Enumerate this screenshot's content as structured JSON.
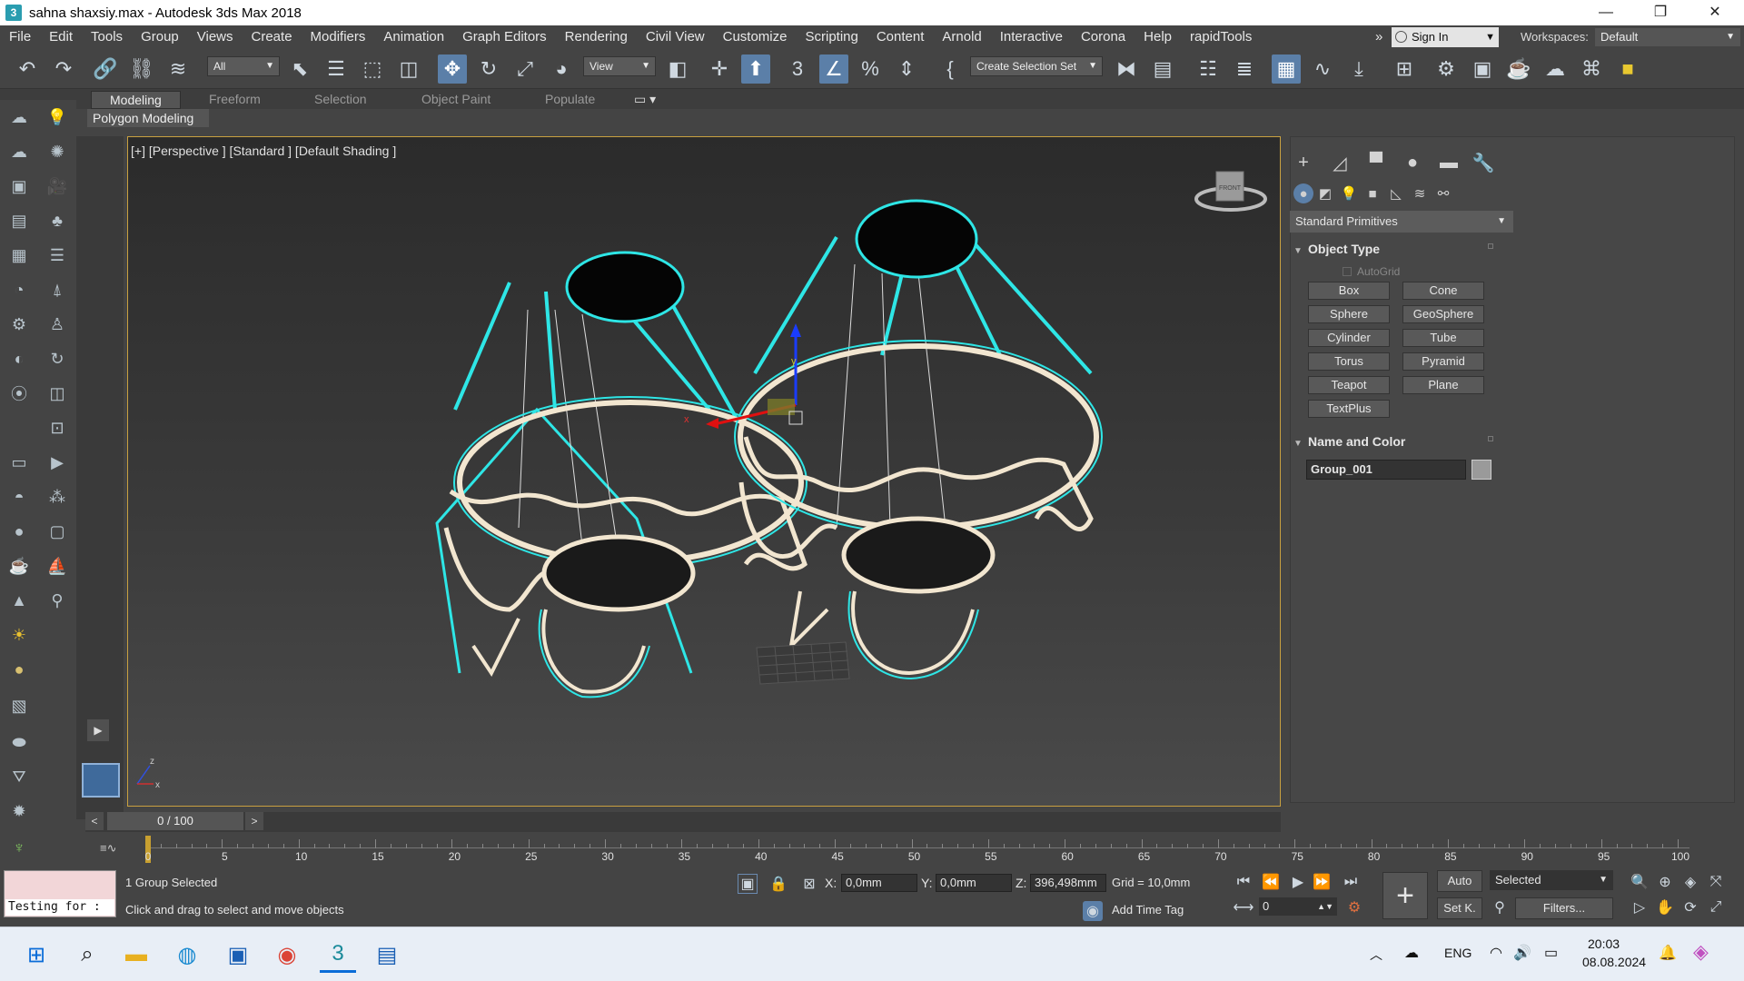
{
  "window": {
    "title": "sahna shaxsiy.max - Autodesk 3ds Max 2018",
    "app_icon": "3",
    "minimize": "—",
    "restore": "❐",
    "close": "✕"
  },
  "menu": [
    "File",
    "Edit",
    "Tools",
    "Group",
    "Views",
    "Create",
    "Modifiers",
    "Animation",
    "Graph Editors",
    "Rendering",
    "Civil View",
    "Customize",
    "Scripting",
    "Content",
    "Arnold",
    "Interactive",
    "Corona",
    "Help",
    "rapidTools"
  ],
  "menu_more": "»",
  "signin": {
    "label": "Sign In"
  },
  "workspace": {
    "label": "Workspaces:",
    "value": "Default"
  },
  "toolbar": {
    "filter_value": "All",
    "refcoord_value": "View",
    "selection_set": "Create Selection Set"
  },
  "ribbon": {
    "tabs": [
      "Modeling",
      "Freeform",
      "Selection",
      "Object Paint",
      "Populate"
    ],
    "active": "Modeling",
    "panel": "Polygon Modeling"
  },
  "viewport": {
    "label": "[+] [Perspective ] [Standard ] [Default Shading ]",
    "gizmo_x": "x",
    "gizmo_y": "y",
    "axis_x": "x",
    "axis_z": "z",
    "cube_label": "FRONT"
  },
  "command_panel": {
    "dropdown": "Standard Primitives",
    "object_type": {
      "title": "Object Type",
      "autogrid": "AutoGrid",
      "buttons": [
        "Box",
        "Cone",
        "Sphere",
        "GeoSphere",
        "Cylinder",
        "Tube",
        "Torus",
        "Pyramid",
        "Teapot",
        "Plane",
        "TextPlus"
      ]
    },
    "name_color": {
      "title": "Name and Color",
      "name": "Group_001",
      "swatch_color": "#9a9a9a"
    }
  },
  "timeline": {
    "position": "0 / 100",
    "ticks": [
      "0",
      "5",
      "10",
      "15",
      "20",
      "25",
      "30",
      "35",
      "40",
      "45",
      "50",
      "55",
      "60",
      "65",
      "70",
      "75",
      "80",
      "85",
      "90",
      "95",
      "100"
    ],
    "mini_curve": "≡∿"
  },
  "status": {
    "maxscript": "Testing for :",
    "selection": "1 Group Selected",
    "prompt": "Click and drag to select and move objects",
    "x_label": "X:",
    "x": "0,0mm",
    "y_label": "Y:",
    "y": "0,0mm",
    "z_label": "Z:",
    "z": "396,498mm",
    "grid": "Grid = 10,0mm",
    "add_time_tag": "Add Time Tag",
    "auto": "Auto",
    "setk": "Set K.",
    "key_filter": "Selected",
    "filters": "Filters...",
    "frame": "0"
  },
  "taskbar": {
    "lang": "ENG",
    "time": "20:03",
    "date": "08.08.2024",
    "win_icon": "⊞"
  },
  "colors": {
    "selection": "#2ee6e6",
    "lamp_ring": "#f2e6d0",
    "accent": "#5b7fa8",
    "viewport_border": "#c8a040"
  }
}
